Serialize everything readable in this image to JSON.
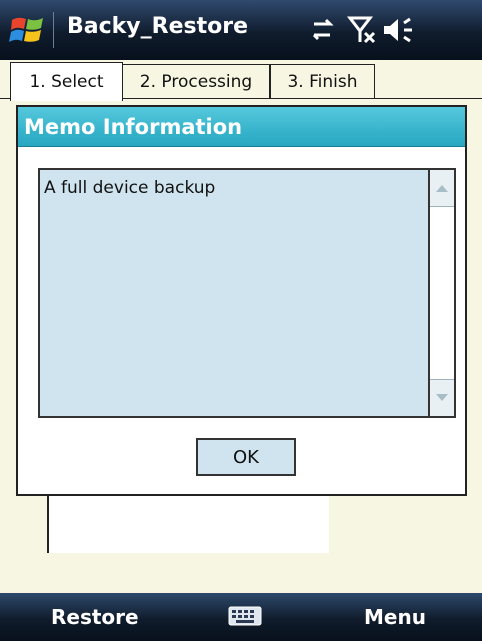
{
  "titlebar": {
    "title": "Backy_Restore",
    "icons": [
      "windows-start-icon",
      "sync-arrows-icon",
      "no-signal-icon",
      "speaker-icon"
    ]
  },
  "tabs": [
    {
      "label": "1. Select",
      "active": true
    },
    {
      "label": "2. Processing",
      "active": false
    },
    {
      "label": "3. Finish",
      "active": false
    }
  ],
  "dialog": {
    "title": "Memo Information",
    "memo_text": "A full device backup",
    "ok_label": "OK"
  },
  "softkeys": {
    "left": "Restore",
    "center_icon": "keyboard-icon",
    "right": "Menu"
  },
  "colors": {
    "titlebar": "#101c2d",
    "dialog_header": "#37b4cc",
    "memo_bg": "#cfe4ee",
    "page_bg": "#f7f6e2"
  }
}
